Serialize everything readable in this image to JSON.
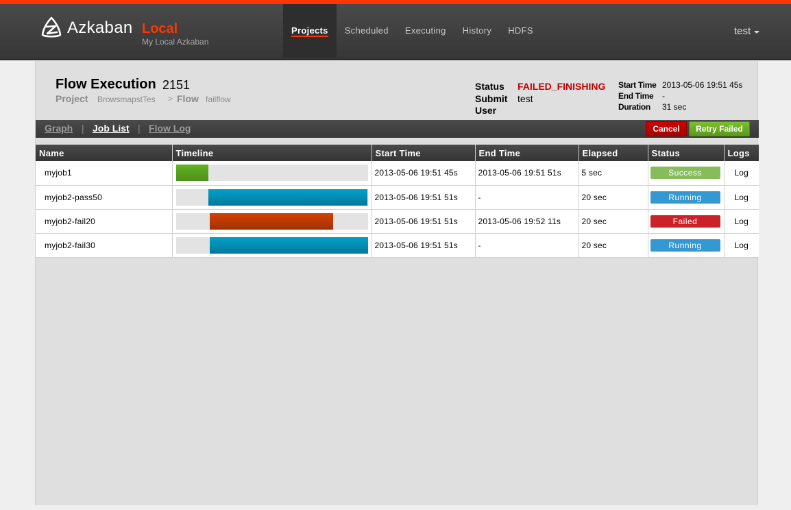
{
  "header": {
    "brand": "Azkaban",
    "environment": "Local",
    "subtitle": "My Local Azkaban",
    "accent_color": "#ff3601",
    "nav": [
      {
        "label": "Projects",
        "active": true
      },
      {
        "label": "Scheduled",
        "active": false
      },
      {
        "label": "Executing",
        "active": false
      },
      {
        "label": "History",
        "active": false
      },
      {
        "label": "HDFS",
        "active": false
      }
    ],
    "user": "test"
  },
  "flow": {
    "title": "Flow Execution",
    "exec_id": "2151",
    "project_label": "Project",
    "project_name": "BrowsmapstTes",
    "separator": ">",
    "flow_label": "Flow",
    "flow_name": "failflow",
    "status_label": "Status",
    "status_value": "FAILED_FINISHING",
    "submit_user_label_1": "Submit",
    "submit_user_label_2": "User",
    "submit_user_value": "test",
    "start_time_label": "Start Time",
    "start_time_value": "2013-05-06 19:51 45s",
    "end_time_label": "End Time",
    "end_time_value": "-",
    "duration_label": "Duration",
    "duration_value": "31 sec"
  },
  "toolbar": {
    "tabs": [
      {
        "label": "Graph",
        "active": false
      },
      {
        "label": "Job List",
        "active": true
      },
      {
        "label": "Flow Log",
        "active": false
      }
    ],
    "tab_separator": "|",
    "cancel_label": "Cancel",
    "retry_label": "Retry Failed"
  },
  "table": {
    "columns": [
      "Name",
      "Timeline",
      "Start Time",
      "End Time",
      "Elapsed",
      "Status",
      "Logs"
    ],
    "rows": [
      {
        "name": "myjob1",
        "timeline_start_pct": 0,
        "timeline_end_pct": 17,
        "timeline_state": "success",
        "start": "2013-05-06 19:51 45s",
        "end": "2013-05-06 19:51 51s",
        "elapsed": "5 sec",
        "status": "Success",
        "log": "Log"
      },
      {
        "name": "myjob2-pass50",
        "timeline_start_pct": 17,
        "timeline_end_pct": 100,
        "timeline_state": "running",
        "start": "2013-05-06 19:51 51s",
        "end": "-",
        "elapsed": "20 sec",
        "status": "Running",
        "log": "Log"
      },
      {
        "name": "myjob2-fail20",
        "timeline_start_pct": 17.5,
        "timeline_end_pct": 82,
        "timeline_state": "failed",
        "start": "2013-05-06 19:51 51s",
        "end": "2013-05-06 19:52 11s",
        "elapsed": "20 sec",
        "status": "Failed",
        "log": "Log"
      },
      {
        "name": "myjob2-fail30",
        "timeline_start_pct": 17.5,
        "timeline_end_pct": 100,
        "timeline_state": "running",
        "start": "2013-05-06 19:51 51s",
        "end": "-",
        "elapsed": "20 sec",
        "status": "Running",
        "log": "Log"
      }
    ]
  }
}
